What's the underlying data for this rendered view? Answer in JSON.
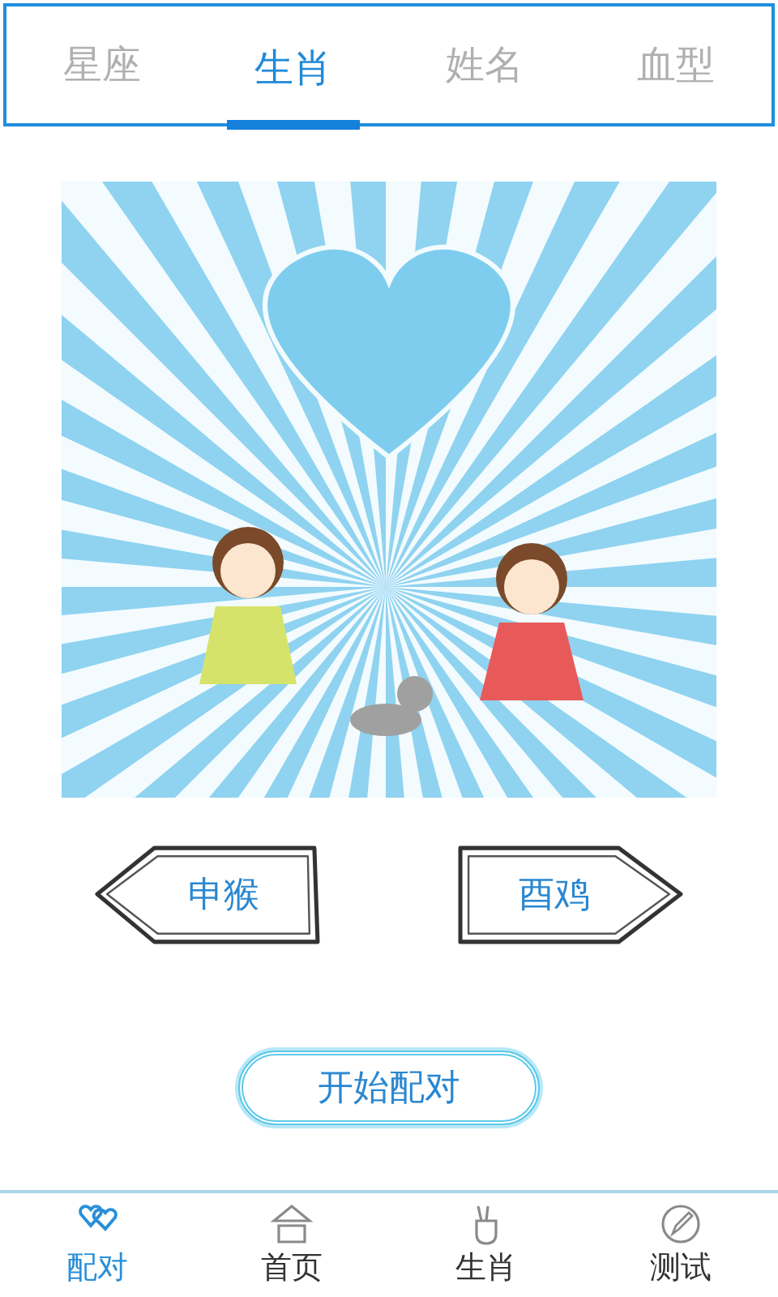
{
  "tabs": [
    {
      "label": "星座",
      "selected": false
    },
    {
      "label": "生肖",
      "selected": true
    },
    {
      "label": "姓名",
      "selected": false
    },
    {
      "label": "血型",
      "selected": false
    }
  ],
  "pickers": [
    {
      "label": "申猴",
      "kind": "left"
    },
    {
      "label": "酉鸡",
      "kind": "right"
    }
  ],
  "start_button": "开始配对",
  "bottom_nav": [
    {
      "label": "配对",
      "kind": "hearts",
      "selected": true
    },
    {
      "label": "首页",
      "kind": "home",
      "selected": false
    },
    {
      "label": "生肖",
      "kind": "hand",
      "selected": false
    },
    {
      "label": "测试",
      "kind": "pencil",
      "selected": false
    }
  ]
}
